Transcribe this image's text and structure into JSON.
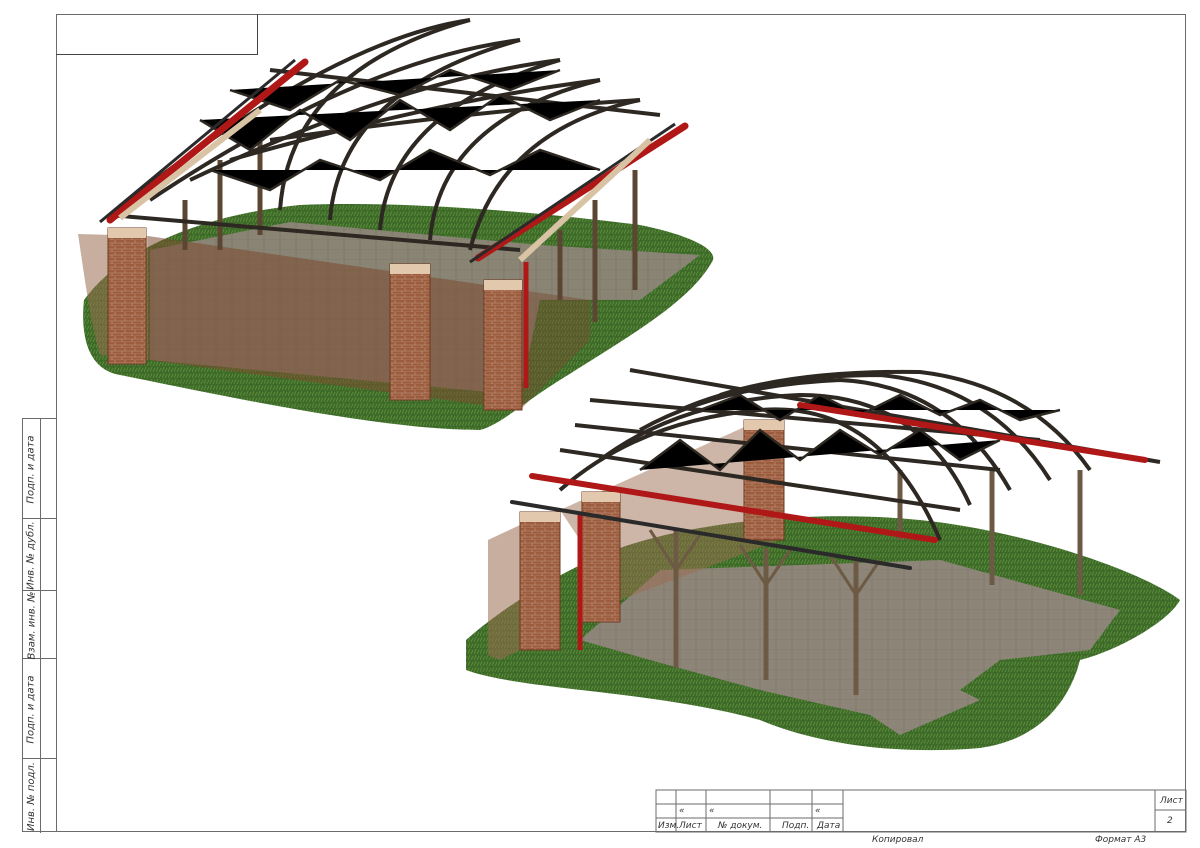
{
  "side_stamp": {
    "cells": [
      "Подп. и дата",
      "Инв. № дубл.",
      "Взам. инв. №",
      "Подп. и дата",
      "Инв. № подл."
    ]
  },
  "title_block": {
    "col_headers": [
      "Изм.",
      "Лист",
      "№ докум.",
      "Подп.",
      "Дата"
    ],
    "row_marks": [
      "«",
      "«",
      "«"
    ],
    "sheet_label": "Лист",
    "sheet_number": "2",
    "copied_label": "Копировал",
    "format_label": "Формат А3"
  },
  "colors": {
    "grass": "#3f6b2a",
    "paving": "#8a8275",
    "brick": "#9a5a3c",
    "steel_dark": "#3a3128",
    "steel_red": "#b01818",
    "wall_translucent": "#9b6b4f"
  }
}
